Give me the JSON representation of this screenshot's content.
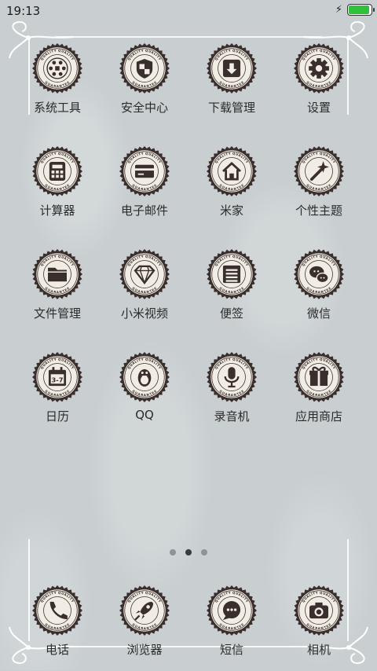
{
  "status_bar": {
    "time": "19:13",
    "battery_level": 1.0
  },
  "badge_text": {
    "top": "QUALITY QUALITY",
    "bottom": "GUARANTEE"
  },
  "apps": [
    {
      "label": "系统工具",
      "icon": "folder-grid-icon"
    },
    {
      "label": "安全中心",
      "icon": "shield-icon"
    },
    {
      "label": "下载管理",
      "icon": "download-icon"
    },
    {
      "label": "设置",
      "icon": "gear-icon"
    },
    {
      "label": "计算器",
      "icon": "calculator-icon"
    },
    {
      "label": "电子邮件",
      "icon": "card-icon"
    },
    {
      "label": "米家",
      "icon": "home-icon"
    },
    {
      "label": "个性主题",
      "icon": "magic-wand-icon"
    },
    {
      "label": "文件管理",
      "icon": "folder-icon"
    },
    {
      "label": "小米视频",
      "icon": "diamond-icon"
    },
    {
      "label": "便签",
      "icon": "note-list-icon"
    },
    {
      "label": "微信",
      "icon": "wechat-icon"
    },
    {
      "label": "日历",
      "icon": "calendar-icon",
      "icon_text": "3-7"
    },
    {
      "label": "QQ",
      "icon": "penguin-icon"
    },
    {
      "label": "录音机",
      "icon": "microphone-icon"
    },
    {
      "label": "应用商店",
      "icon": "gift-icon"
    }
  ],
  "page_indicator": {
    "pages": 3,
    "current": 2
  },
  "dock": [
    {
      "label": "电话",
      "icon": "phone-icon"
    },
    {
      "label": "浏览器",
      "icon": "rocket-icon"
    },
    {
      "label": "短信",
      "icon": "message-icon"
    },
    {
      "label": "相机",
      "icon": "camera-icon"
    }
  ],
  "colors": {
    "badge_dark": "#3a2f2c",
    "badge_cream": "#f2ede4",
    "background": "#c9cfd1",
    "battery_green": "#2ec13b"
  }
}
